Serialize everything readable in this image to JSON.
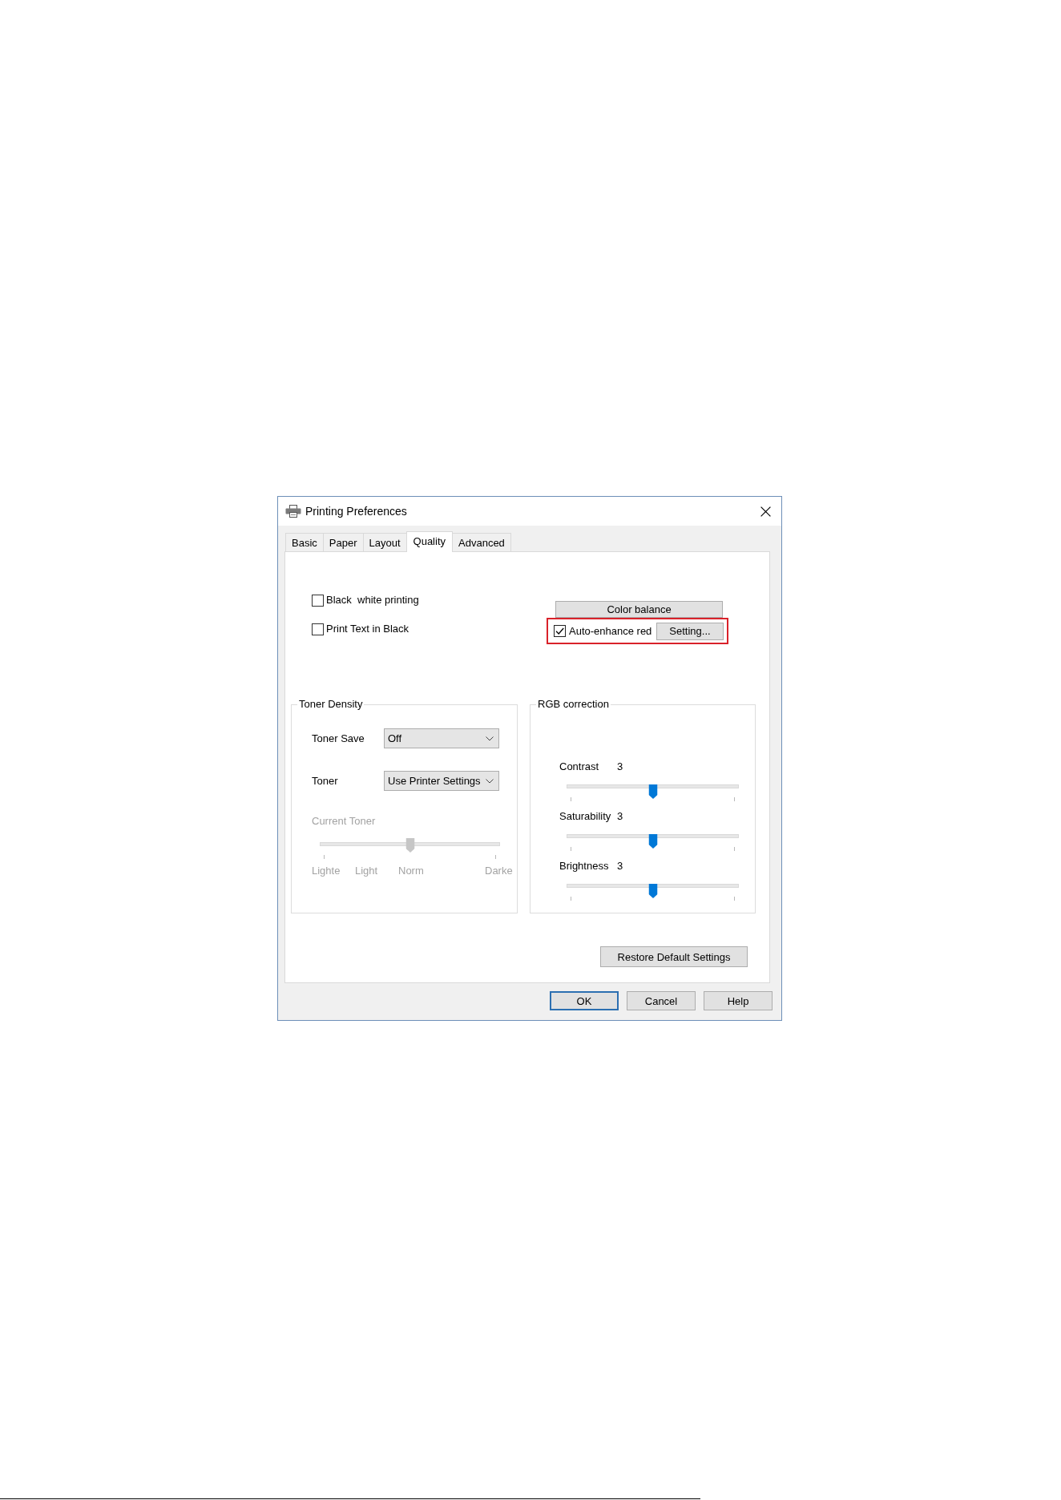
{
  "window": {
    "title": "Printing Preferences"
  },
  "tabs": [
    {
      "label": "Basic",
      "selected": false
    },
    {
      "label": "Paper",
      "selected": false
    },
    {
      "label": "Layout",
      "selected": false
    },
    {
      "label": "Quality",
      "selected": true
    },
    {
      "label": "Advanced",
      "selected": false
    }
  ],
  "options": [
    {
      "label": "Black  white printing",
      "checked": false
    },
    {
      "label": "Print Text in Black",
      "checked": false
    }
  ],
  "color_balance": {
    "button": "Color balance",
    "auto_enhance": {
      "label": "Auto-enhance red",
      "checked": true,
      "highlighted": true
    },
    "setting_button": "Setting..."
  },
  "toner_density": {
    "title": "Toner Density",
    "fields": [
      {
        "label": "Toner Save",
        "value": "Off"
      },
      {
        "label": "Toner",
        "value": "Use Printer Settings"
      }
    ],
    "current_toner": {
      "label": "Current Toner",
      "disabled": true,
      "level": 0.5,
      "tick_labels": [
        "Lighte",
        "Light",
        "Norm",
        "Darke"
      ]
    }
  },
  "rgb_correction": {
    "title": "RGB correction",
    "sliders": [
      {
        "label": "Contrast",
        "reading": "3",
        "level": 0.5
      },
      {
        "label": "Saturability",
        "reading": "3",
        "level": 0.5
      },
      {
        "label": "Brightness",
        "reading": "3",
        "level": 0.5
      }
    ]
  },
  "restore_button": "Restore Default Settings",
  "footer_buttons": [
    {
      "label": "OK",
      "default": true
    },
    {
      "label": "Cancel",
      "default": false
    },
    {
      "label": "Help",
      "default": false
    }
  ]
}
